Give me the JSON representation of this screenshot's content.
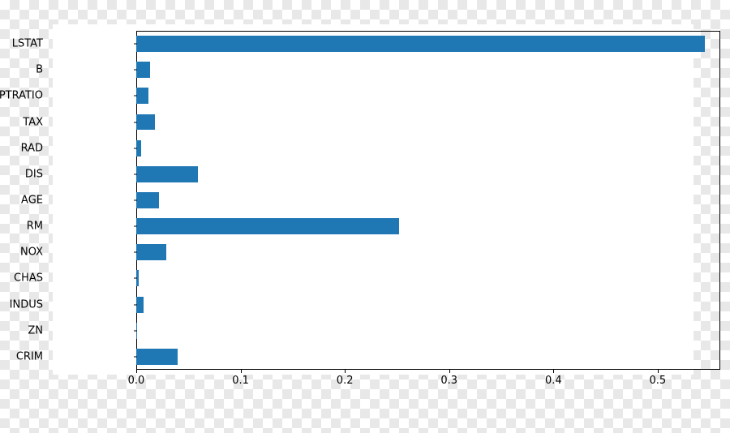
{
  "chart_data": {
    "type": "bar",
    "orientation": "horizontal",
    "categories": [
      "LSTAT",
      "B",
      "PTRATIO",
      "TAX",
      "RAD",
      "DIS",
      "AGE",
      "RM",
      "NOX",
      "CHAS",
      "INDUS",
      "ZN",
      "CRIM"
    ],
    "values": [
      0.545,
      0.013,
      0.012,
      0.018,
      0.005,
      0.059,
      0.022,
      0.252,
      0.029,
      0.002,
      0.007,
      0.001,
      0.04
    ],
    "title": "",
    "xlabel": "",
    "ylabel": "",
    "xlim": [
      0.0,
      0.56
    ],
    "x_ticks": [
      0.0,
      0.1,
      0.2,
      0.3,
      0.4,
      0.5
    ],
    "x_tick_labels": [
      "0.0",
      "0.1",
      "0.2",
      "0.3",
      "0.4",
      "0.5"
    ],
    "bar_color": "#1f77b4"
  }
}
